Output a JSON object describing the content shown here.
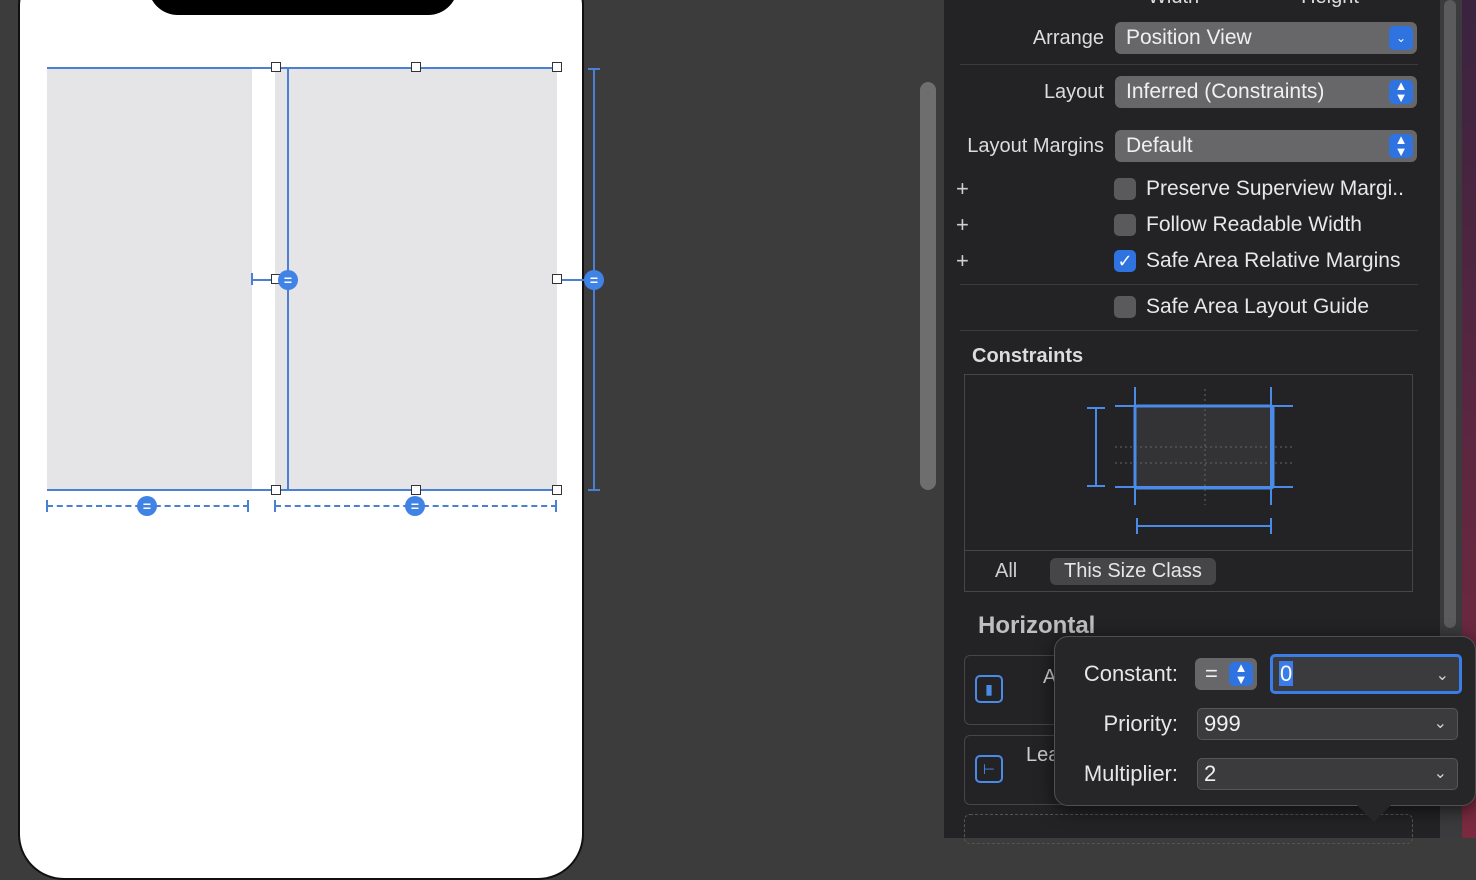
{
  "inspector": {
    "header": {
      "width_label": "Width",
      "height_label": "Height"
    },
    "arrange": {
      "label": "Arrange",
      "value": "Position View"
    },
    "layout": {
      "label": "Layout",
      "value": "Inferred (Constraints)"
    },
    "layout_margins": {
      "label": "Layout Margins",
      "value": "Default"
    },
    "checkboxes": [
      {
        "label": "Preserve Superview Margi..",
        "checked": false
      },
      {
        "label": "Follow Readable Width",
        "checked": false
      },
      {
        "label": "Safe Area Relative Margins",
        "checked": true
      },
      {
        "label": "Safe Area Layout Guide",
        "checked": false
      }
    ],
    "plus_glyph": "+",
    "constraints": {
      "title": "Constraints",
      "tabs": [
        {
          "label": "All",
          "selected": false
        },
        {
          "label": "This Size Class",
          "selected": true
        }
      ]
    },
    "horizontal": {
      "title": "Horizontal",
      "rows": [
        {
          "label": "A",
          "icon": "align-icon"
        },
        {
          "label": "Lea",
          "icon": "leading-icon"
        }
      ]
    }
  },
  "popover": {
    "constant": {
      "label": "Constant:",
      "relation": "=",
      "value": "0"
    },
    "priority": {
      "label": "Priority:",
      "value": "999"
    },
    "multiplier": {
      "label": "Multiplier:",
      "value": "2"
    }
  },
  "canvas": {
    "equal_badge": "="
  },
  "colors": {
    "accent": "#3f83e6",
    "inspector_bg": "#232224",
    "canvas_bg": "#3c3c3c"
  }
}
